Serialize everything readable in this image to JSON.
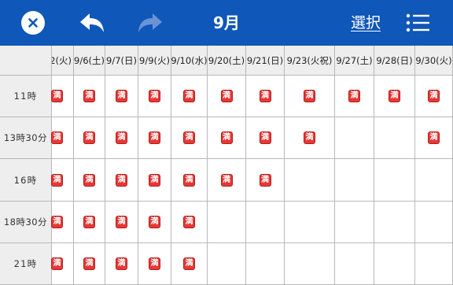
{
  "header": {
    "month": "9月",
    "select_label": "選択"
  },
  "colors": {
    "header_bg": "#0f57b8",
    "mark_bg": "#e53935",
    "grid_line": "#b8b8b8",
    "header_cell_bg": "#eeeeee"
  },
  "mark_symbol": "満",
  "dates": [
    "2(火)",
    "9/6(土)",
    "9/7(日)",
    "9/9(火)",
    "9/10(水)",
    "9/20(土)",
    "9/21(日)",
    "9/23(火祝)",
    "9/27(土)",
    "9/28(日)",
    "9/30(火)"
  ],
  "times": [
    "11時",
    "13時30分",
    "16時",
    "18時30分",
    "21時"
  ],
  "full": [
    [
      true,
      true,
      true,
      true,
      true,
      true,
      true,
      true,
      true,
      true,
      true
    ],
    [
      true,
      true,
      true,
      true,
      true,
      true,
      true,
      true,
      false,
      false,
      true
    ],
    [
      true,
      true,
      true,
      true,
      true,
      true,
      true,
      false,
      false,
      false,
      false
    ],
    [
      true,
      true,
      true,
      true,
      true,
      false,
      false,
      false,
      false,
      false,
      false
    ],
    [
      true,
      true,
      true,
      true,
      true,
      false,
      false,
      false,
      false,
      false,
      false
    ]
  ]
}
